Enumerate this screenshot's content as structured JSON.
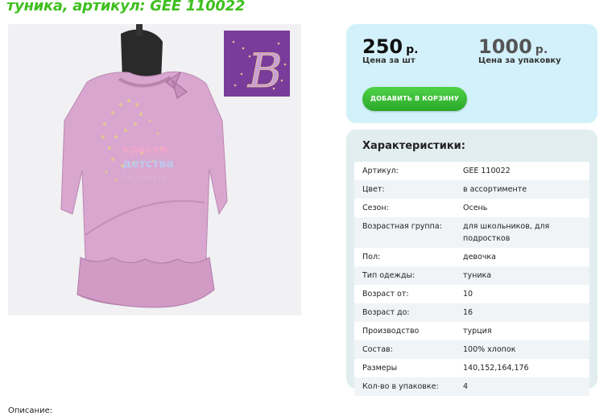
{
  "title": "туника, артикул: GEE 110022",
  "photo": {
    "watermark_line1": "краски",
    "watermark_line2": "детства",
    "watermark_line3": "crc.baby.ru",
    "inset_letter": "B"
  },
  "prices": {
    "unit": {
      "value": "250",
      "currency": "р.",
      "caption": "Цена за шт"
    },
    "pack": {
      "value": "1000",
      "currency": "р.",
      "caption": "Цена за упаковку"
    },
    "add_to_cart_label": "ДОБАВИТЬ В КОРЗИНУ"
  },
  "specs": {
    "heading": "Характеристики:",
    "rows": [
      {
        "key": "Артикул:",
        "value": "GEE 110022"
      },
      {
        "key": "Цвет:",
        "value": "в ассортименте"
      },
      {
        "key": "Сезон:",
        "value": "Осень"
      },
      {
        "key": "Возрастная группа:",
        "value": "для школьников, для подростков"
      },
      {
        "key": "Пол:",
        "value": "девочка"
      },
      {
        "key": "Тип одежды:",
        "value": "туника"
      },
      {
        "key": "Возраст от:",
        "value": "10"
      },
      {
        "key": "Возраст до:",
        "value": "16"
      },
      {
        "key": "Производство",
        "value": "турция"
      },
      {
        "key": "Состав:",
        "value": "100% хлопок"
      },
      {
        "key": "Размеры",
        "value": "140,152,164,176"
      },
      {
        "key": "Кол-во в упаковке:",
        "value": "4"
      }
    ]
  },
  "description_label": "Описание:",
  "colors": {
    "title_green": "#3fbf1f",
    "price_box_bg": "#d3f1fb",
    "specs_box_bg": "#e2edf0",
    "button_green": "#2fb02d",
    "tunic_pink": "#d9a6cf",
    "inset_purple": "#7a3c9a"
  }
}
